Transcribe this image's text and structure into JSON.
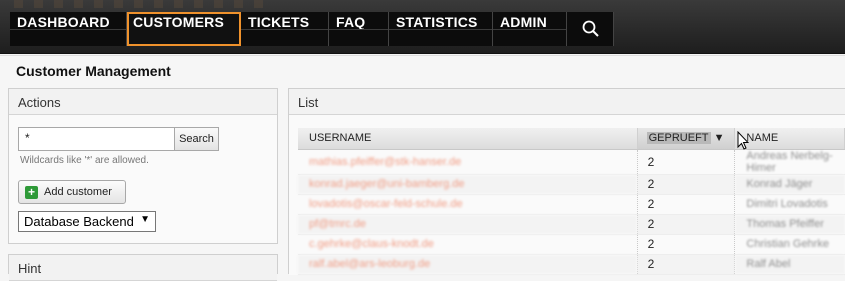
{
  "nav": {
    "items": [
      {
        "label": "DASHBOARD",
        "active": false
      },
      {
        "label": "CUSTOMERS",
        "active": true
      },
      {
        "label": "TICKETS",
        "active": false
      },
      {
        "label": "FAQ",
        "active": false
      },
      {
        "label": "STATISTICS",
        "active": false
      },
      {
        "label": "ADMIN",
        "active": false
      }
    ],
    "search_icon": "magnifier-icon",
    "active_color": "#f0922c"
  },
  "page_title": "Customer Management",
  "actions": {
    "title": "Actions",
    "search_value": "*",
    "search_button": "Search",
    "hint": "Wildcards like '*' are allowed.",
    "add_customer": "Add customer",
    "backend_selected": "Database Backend"
  },
  "hint_box": {
    "title": "Hint"
  },
  "list": {
    "title": "List",
    "columns": [
      "USERNAME",
      "GEPRUEFT",
      "NAME"
    ],
    "sort_indicator": "▼",
    "rows": [
      {
        "username": "mathias.pfeiffer@stk-hanser.de",
        "geprueft": "2",
        "name": "Andreas Nerbelg-Himer"
      },
      {
        "username": "konrad.jaeger@uni-bamberg.de",
        "geprueft": "2",
        "name": "Konrad Jäger"
      },
      {
        "username": "lovadotis@oscar-feld-schule.de",
        "geprueft": "2",
        "name": "Dimitri Lovadotis"
      },
      {
        "username": "pf@tmrc.de",
        "geprueft": "2",
        "name": "Thomas Pfeiffer"
      },
      {
        "username": "c.gehrke@claus-knodt.de",
        "geprueft": "2",
        "name": "Christian Gehrke"
      },
      {
        "username": "ralf.abel@ars-leoburg.de",
        "geprueft": "2",
        "name": "Ralf Abel"
      }
    ]
  }
}
